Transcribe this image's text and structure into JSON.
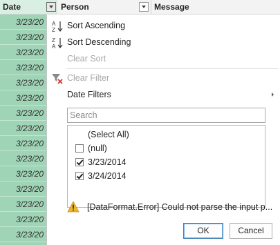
{
  "columns": {
    "date": "Date",
    "person": "Person",
    "message": "Message"
  },
  "date_cells": [
    "3/23/20",
    "3/23/20",
    "3/23/20",
    "3/23/20",
    "3/23/20",
    "3/23/20",
    "3/23/20",
    "3/23/20",
    "3/23/20",
    "3/23/20",
    "3/23/20",
    "3/23/20",
    "3/23/20",
    "3/23/20",
    "3/23/20"
  ],
  "menu": {
    "sort_ascending": "Sort Ascending",
    "sort_descending": "Sort Descending",
    "clear_sort": "Clear Sort",
    "clear_filter": "Clear Filter",
    "date_filters": "Date Filters"
  },
  "search": {
    "placeholder": "Search",
    "value": ""
  },
  "filter_list": [
    {
      "label": "(Select All)",
      "has_checkbox": false,
      "checked": false
    },
    {
      "label": "(null)",
      "has_checkbox": true,
      "checked": false
    },
    {
      "label": "3/23/2014",
      "has_checkbox": true,
      "checked": true
    },
    {
      "label": "3/24/2014",
      "has_checkbox": true,
      "checked": true
    }
  ],
  "warning": "[DataFormat.Error] Could not parse the input p...",
  "buttons": {
    "ok": "OK",
    "cancel": "Cancel"
  },
  "colors": {
    "date_column": "#9fd4b6",
    "date_header": "#d9efe3",
    "warning": "#f2b62a",
    "filter_x": "#d9332b"
  }
}
